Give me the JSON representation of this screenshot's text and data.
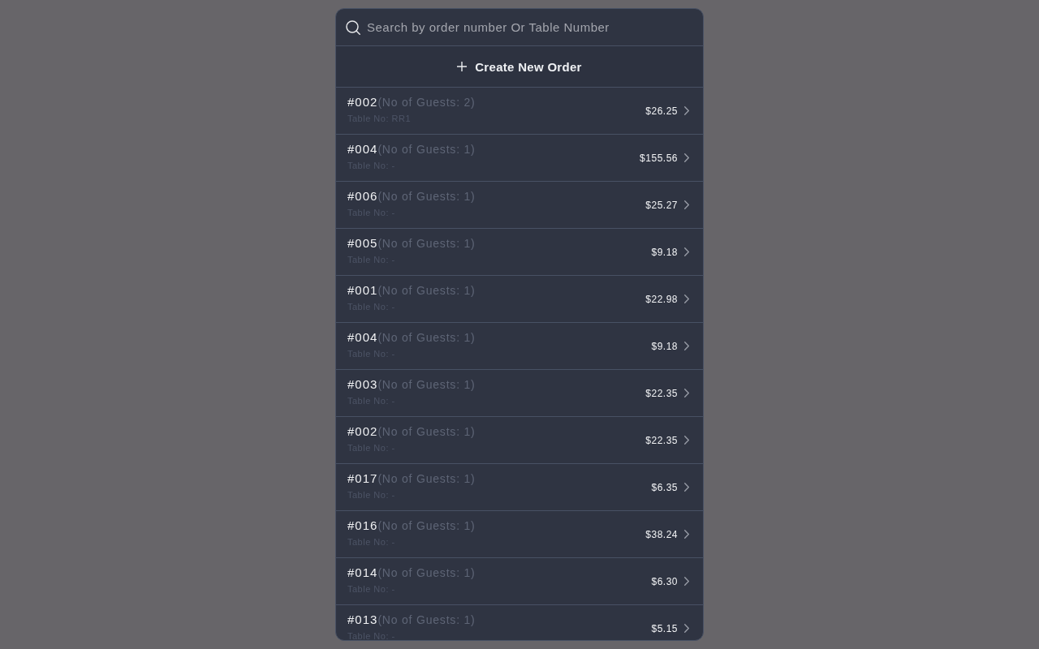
{
  "search": {
    "placeholder": "Search by order number Or Table Number"
  },
  "create_button": {
    "label": "Create New Order"
  },
  "orders": [
    {
      "number": "#002",
      "guests": "(No of Guests: 2)",
      "table": "Table No: RR1",
      "total": "$26.25"
    },
    {
      "number": "#004",
      "guests": "(No of Guests: 1)",
      "table": "Table No: -",
      "total": "$155.56"
    },
    {
      "number": "#006",
      "guests": "(No of Guests: 1)",
      "table": "Table No: -",
      "total": "$25.27"
    },
    {
      "number": "#005",
      "guests": "(No of Guests: 1)",
      "table": "Table No: -",
      "total": "$9.18"
    },
    {
      "number": "#001",
      "guests": "(No of Guests: 1)",
      "table": "Table No: -",
      "total": "$22.98"
    },
    {
      "number": "#004",
      "guests": "(No of Guests: 1)",
      "table": "Table No: -",
      "total": "$9.18"
    },
    {
      "number": "#003",
      "guests": "(No of Guests: 1)",
      "table": "Table No: -",
      "total": "$22.35"
    },
    {
      "number": "#002",
      "guests": "(No of Guests: 1)",
      "table": "Table No: -",
      "total": "$22.35"
    },
    {
      "number": "#017",
      "guests": "(No of Guests: 1)",
      "table": "Table No: -",
      "total": "$6.35"
    },
    {
      "number": "#016",
      "guests": "(No of Guests: 1)",
      "table": "Table No: -",
      "total": "$38.24"
    },
    {
      "number": "#014",
      "guests": "(No of Guests: 1)",
      "table": "Table No: -",
      "total": "$6.30"
    },
    {
      "number": "#013",
      "guests": "(No of Guests: 1)",
      "table": "Table No: -",
      "total": "$5.15"
    }
  ]
}
